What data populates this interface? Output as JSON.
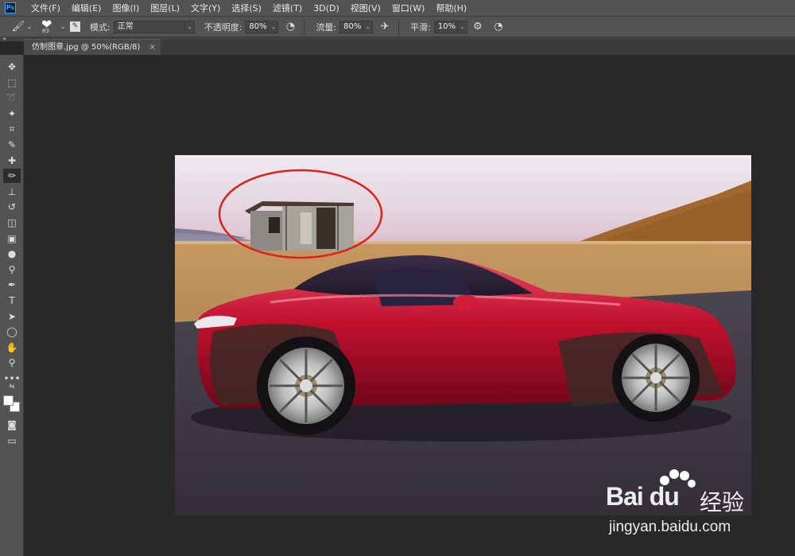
{
  "app": {
    "logo": "Ps"
  },
  "menu": [
    "文件(F)",
    "编辑(E)",
    "图像(I)",
    "图层(L)",
    "文字(Y)",
    "选择(S)",
    "滤镜(T)",
    "3D(D)",
    "视图(V)",
    "窗口(W)",
    "帮助(H)"
  ],
  "options": {
    "brush_size": "83",
    "mode_label": "模式:",
    "mode_value": "正常",
    "opacity_label": "不透明度:",
    "opacity_value": "80%",
    "flow_label": "流量:",
    "flow_value": "80%",
    "smoothing_label": "平滑:",
    "smoothing_value": "10%"
  },
  "document": {
    "tab_title": "仿制图章.jpg @ 50%(RGB/8)",
    "close_glyph": "×"
  },
  "toolbar": {
    "tools": [
      {
        "name": "move-tool",
        "glyph": "✥"
      },
      {
        "name": "marquee-tool",
        "glyph": "⬚"
      },
      {
        "name": "lasso-tool",
        "glyph": "➰"
      },
      {
        "name": "magic-wand-tool",
        "glyph": "✦"
      },
      {
        "name": "crop-tool",
        "glyph": "⌗"
      },
      {
        "name": "eyedropper-tool",
        "glyph": "✎"
      },
      {
        "name": "healing-brush-tool",
        "glyph": "✚"
      },
      {
        "name": "brush-tool",
        "glyph": "✏"
      },
      {
        "name": "clone-stamp-tool",
        "glyph": "⊥"
      },
      {
        "name": "history-brush-tool",
        "glyph": "↺"
      },
      {
        "name": "eraser-tool",
        "glyph": "◫"
      },
      {
        "name": "gradient-tool",
        "glyph": "▣"
      },
      {
        "name": "blur-tool",
        "glyph": "●"
      },
      {
        "name": "dodge-tool",
        "glyph": "⚲"
      },
      {
        "name": "pen-tool",
        "glyph": "✒"
      },
      {
        "name": "type-tool",
        "glyph": "T"
      },
      {
        "name": "path-selection-tool",
        "glyph": "➤"
      },
      {
        "name": "shape-tool",
        "glyph": "◯"
      },
      {
        "name": "hand-tool",
        "glyph": "✋"
      },
      {
        "name": "zoom-tool",
        "glyph": "⚲"
      },
      {
        "name": "more-tools",
        "glyph": "•••"
      }
    ],
    "active_tool": "brush-tool"
  },
  "watermark": {
    "brand": "Bai  du",
    "jingyan": "经验",
    "url": "jingyan.baidu.com"
  },
  "colors": {
    "ui_bg": "#535353",
    "canvas_bg": "#282828",
    "circle": "#d8231f",
    "car": "#c0102e"
  }
}
